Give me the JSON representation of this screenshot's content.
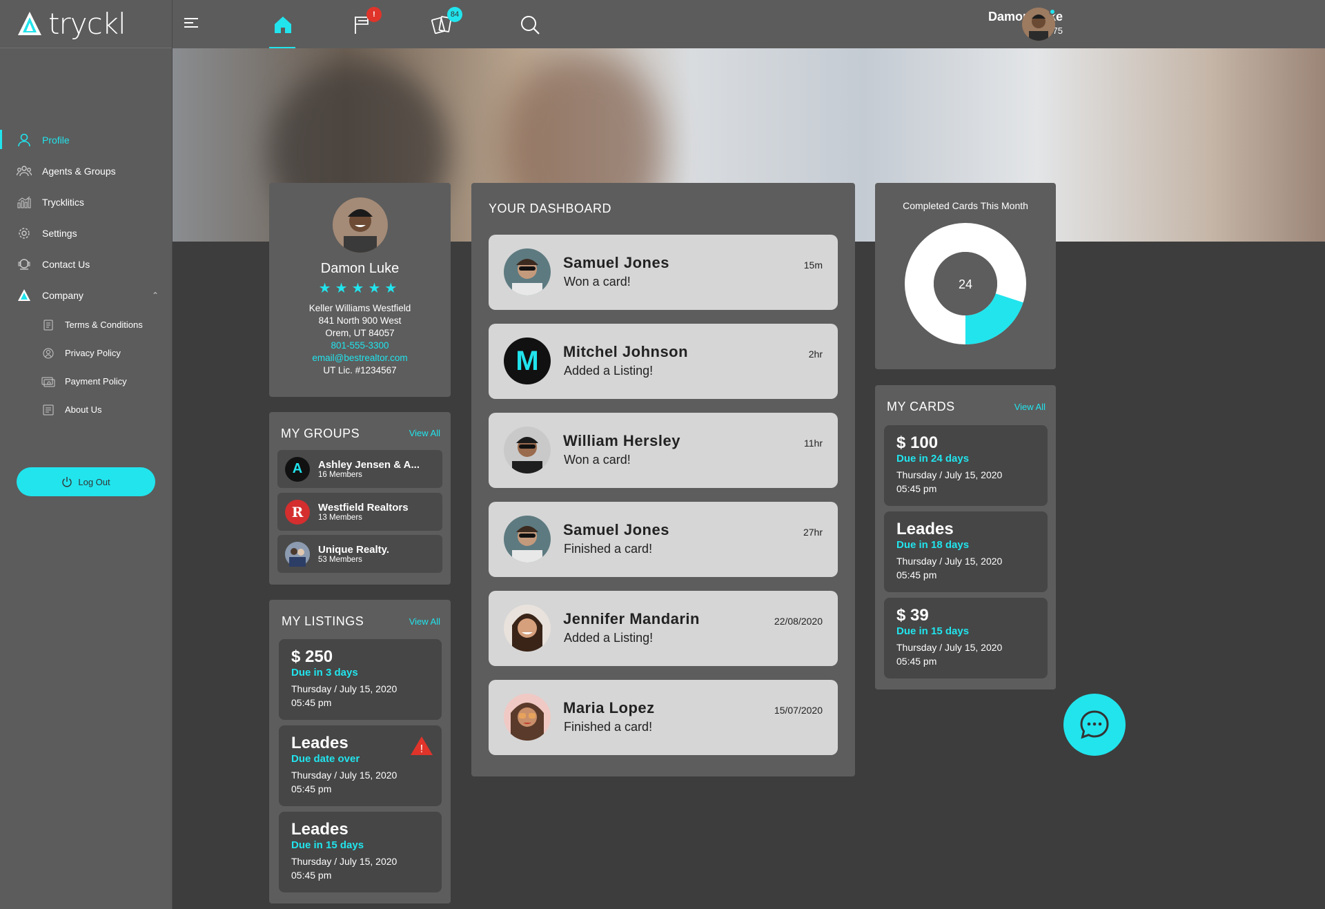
{
  "brand": {
    "name": "tryckl"
  },
  "sidebar": {
    "items": [
      {
        "label": "Profile",
        "icon": "user-icon",
        "active": true
      },
      {
        "label": "Agents & Groups",
        "icon": "group-icon"
      },
      {
        "label": "Trycklitics",
        "icon": "chart-icon"
      },
      {
        "label": "Settings",
        "icon": "gear-icon"
      },
      {
        "label": "Contact Us",
        "icon": "contact-icon"
      },
      {
        "label": "Company",
        "icon": "company-icon",
        "expanded": true
      }
    ],
    "sub_items": [
      {
        "label": "Terms & Conditions",
        "icon": "document-icon"
      },
      {
        "label": "Privacy Policy",
        "icon": "privacy-icon"
      },
      {
        "label": "Payment Policy",
        "icon": "payment-icon"
      },
      {
        "label": "About Us",
        "icon": "info-icon"
      }
    ],
    "logout_label": "Log Out"
  },
  "topbar": {
    "flag_badge": "!",
    "cards_badge": "84",
    "user_name": "Damon Luke",
    "user_balance": "$ 19.75"
  },
  "profile": {
    "name": "Damon Luke",
    "stars": "★★★★★",
    "company": "Keller Williams Westfield",
    "address1": "841 North 900 West",
    "address2": "Orem, UT 84057",
    "phone": "801-555-3300",
    "email": "email@bestrealtor.com",
    "license": "UT Lic. #1234567"
  },
  "groups": {
    "title": "MY GROUPS",
    "view_all": "View All",
    "items": [
      {
        "name": "Ashley Jensen & A...",
        "members": "16 Members",
        "initial": "A"
      },
      {
        "name": "Westfield Realtors",
        "members": "13 Members",
        "initial": "R"
      },
      {
        "name": "Unique Realty.",
        "members": "53 Members",
        "initial": ""
      }
    ]
  },
  "listings": {
    "title": "MY LISTINGS",
    "view_all": "View All",
    "items": [
      {
        "title": "$ 250",
        "due": "Due in 3 days",
        "date": "Thursday / July 15, 2020",
        "time": "05:45 pm"
      },
      {
        "title": "Leades",
        "due": "Due date over",
        "date": "Thursday / July 15, 2020",
        "time": "05:45 pm",
        "warning": "!"
      },
      {
        "title": "Leades",
        "due": "Due in 15 days",
        "date": "Thursday / July 15, 2020",
        "time": "05:45 pm"
      }
    ]
  },
  "dashboard": {
    "title": "YOUR DASHBOARD",
    "feed": [
      {
        "name": "Samuel Jones",
        "action": "Won a card!",
        "time": "15m"
      },
      {
        "name": "Mitchel Johnson",
        "action": "Added a Listing!",
        "time": "2hr",
        "initial": "M"
      },
      {
        "name": "William Hersley",
        "action": "Won a card!",
        "time": "11hr"
      },
      {
        "name": "Samuel Jones",
        "action": "Finished a card!",
        "time": "27hr"
      },
      {
        "name": "Jennifer Mandarin",
        "action": "Added a Listing!",
        "time": "22/08/2020"
      },
      {
        "name": "Maria Lopez",
        "action": "Finished a card!",
        "time": "15/07/2020"
      }
    ]
  },
  "completed": {
    "title": "Completed Cards This Month",
    "value": "24",
    "fraction_cyan": 0.2,
    "colors": {
      "accent": "#21e4ed",
      "ring": "#ffffff"
    }
  },
  "mycards": {
    "title": "MY CARDS",
    "view_all": "View All",
    "items": [
      {
        "title": "$ 100",
        "due": "Due in 24 days",
        "date": "Thursday / July 15, 2020",
        "time": "05:45 pm"
      },
      {
        "title": "Leades",
        "due": "Due in 18 days",
        "date": "Thursday / July 15, 2020",
        "time": "05:45 pm"
      },
      {
        "title": "$ 39",
        "due": "Due in 15 days",
        "date": "Thursday / July 15, 2020",
        "time": "05:45 pm"
      }
    ]
  },
  "colors": {
    "accent": "#21e4ed",
    "sidebar": "#5c5c5c",
    "background": "#3d3d3d",
    "alert": "#e0342a"
  }
}
